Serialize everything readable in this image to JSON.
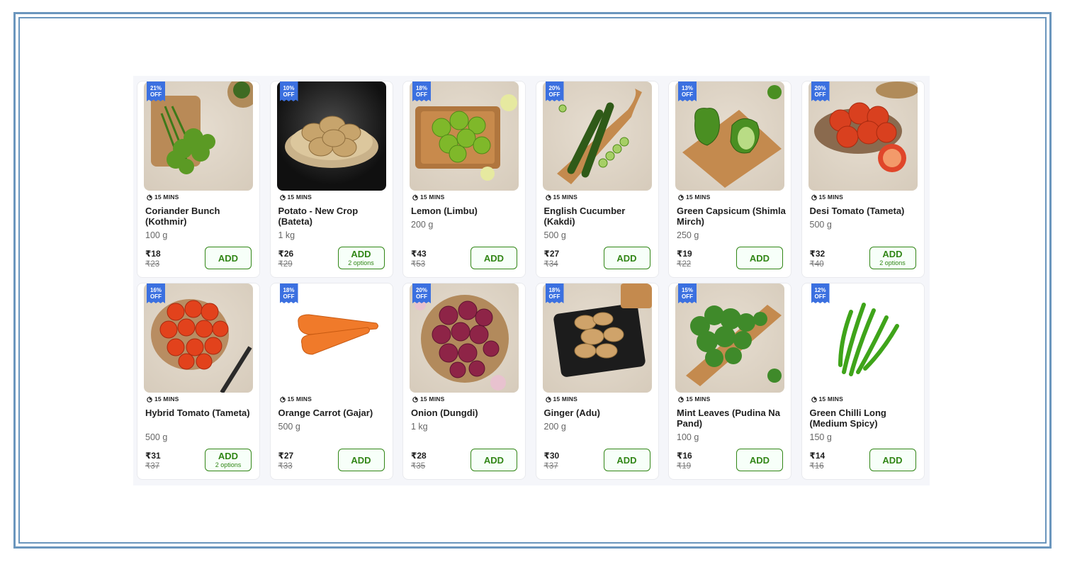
{
  "products": [
    {
      "badge_pct": "21%",
      "badge_off": "OFF",
      "eta": "15 MINS",
      "name": "Coriander Bunch (Kothmir)",
      "weight": "100 g",
      "price": "₹18",
      "mrp": "₹23",
      "add": "ADD",
      "options": ""
    },
    {
      "badge_pct": "10%",
      "badge_off": "OFF",
      "eta": "15 MINS",
      "name": "Potato - New Crop (Bateta)",
      "weight": "1 kg",
      "price": "₹26",
      "mrp": "₹29",
      "add": "ADD",
      "options": "2 options"
    },
    {
      "badge_pct": "18%",
      "badge_off": "OFF",
      "eta": "15 MINS",
      "name": "Lemon (Limbu)",
      "weight": "200 g",
      "price": "₹43",
      "mrp": "₹53",
      "add": "ADD",
      "options": ""
    },
    {
      "badge_pct": "20%",
      "badge_off": "OFF",
      "eta": "15 MINS",
      "name": "English Cucumber (Kakdi)",
      "weight": "500 g",
      "price": "₹27",
      "mrp": "₹34",
      "add": "ADD",
      "options": ""
    },
    {
      "badge_pct": "13%",
      "badge_off": "OFF",
      "eta": "15 MINS",
      "name": "Green Capsicum (Shimla Mirch)",
      "weight": "250 g",
      "price": "₹19",
      "mrp": "₹22",
      "add": "ADD",
      "options": ""
    },
    {
      "badge_pct": "20%",
      "badge_off": "OFF",
      "eta": "15 MINS",
      "name": "Desi Tomato (Tameta)",
      "weight": "500 g",
      "price": "₹32",
      "mrp": "₹40",
      "add": "ADD",
      "options": "2 options"
    },
    {
      "badge_pct": "16%",
      "badge_off": "OFF",
      "eta": "15 MINS",
      "name": "Hybrid Tomato (Tameta)",
      "weight": "500 g",
      "price": "₹31",
      "mrp": "₹37",
      "add": "ADD",
      "options": "2 options"
    },
    {
      "badge_pct": "18%",
      "badge_off": "OFF",
      "eta": "15 MINS",
      "name": "Orange Carrot (Gajar)",
      "weight": "500 g",
      "price": "₹27",
      "mrp": "₹33",
      "add": "ADD",
      "options": ""
    },
    {
      "badge_pct": "20%",
      "badge_off": "OFF",
      "eta": "15 MINS",
      "name": "Onion (Dungdi)",
      "weight": "1 kg",
      "price": "₹28",
      "mrp": "₹35",
      "add": "ADD",
      "options": ""
    },
    {
      "badge_pct": "18%",
      "badge_off": "OFF",
      "eta": "15 MINS",
      "name": "Ginger (Adu)",
      "weight": "200 g",
      "price": "₹30",
      "mrp": "₹37",
      "add": "ADD",
      "options": ""
    },
    {
      "badge_pct": "15%",
      "badge_off": "OFF",
      "eta": "15 MINS",
      "name": "Mint Leaves (Pudina Na Pand)",
      "weight": "100 g",
      "price": "₹16",
      "mrp": "₹19",
      "add": "ADD",
      "options": ""
    },
    {
      "badge_pct": "12%",
      "badge_off": "OFF",
      "eta": "15 MINS",
      "name": "Green Chilli Long (Medium Spicy)",
      "weight": "150 g",
      "price": "₹14",
      "mrp": "₹16",
      "add": "ADD",
      "options": ""
    }
  ]
}
